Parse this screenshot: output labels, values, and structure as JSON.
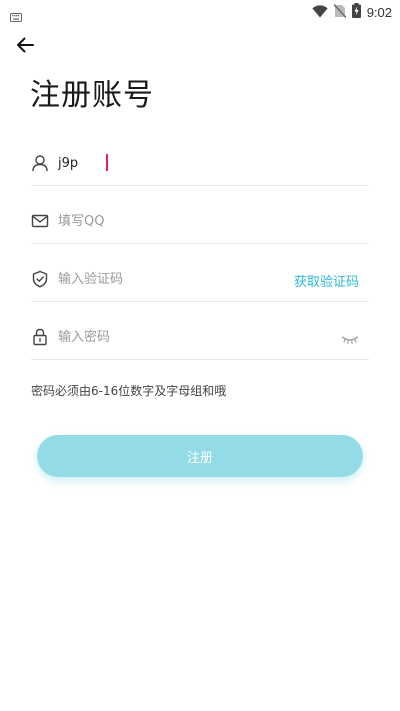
{
  "status_bar": {
    "time": "9:02",
    "icons": [
      "keyboard-icon",
      "wifi-icon",
      "no-sim-icon",
      "battery-charging-icon"
    ]
  },
  "header": {
    "back_icon": "arrow-left-icon",
    "title": "注册账号"
  },
  "form": {
    "username": {
      "value": "j9p",
      "icon": "user-icon"
    },
    "qq": {
      "placeholder": "填写QQ",
      "icon": "mail-icon"
    },
    "code": {
      "placeholder": "输入验证码",
      "icon": "shield-check-icon",
      "action_label": "获取验证码"
    },
    "password": {
      "placeholder": "输入密码",
      "icon": "lock-icon",
      "toggle_icon": "eye-closed-icon"
    },
    "hint": "密码必须由6-16位数字及字母组和哦"
  },
  "actions": {
    "register_label": "注册"
  },
  "colors": {
    "accent": "#2ab8d0",
    "button": "#93dbe6",
    "caret": "#e91e63"
  }
}
